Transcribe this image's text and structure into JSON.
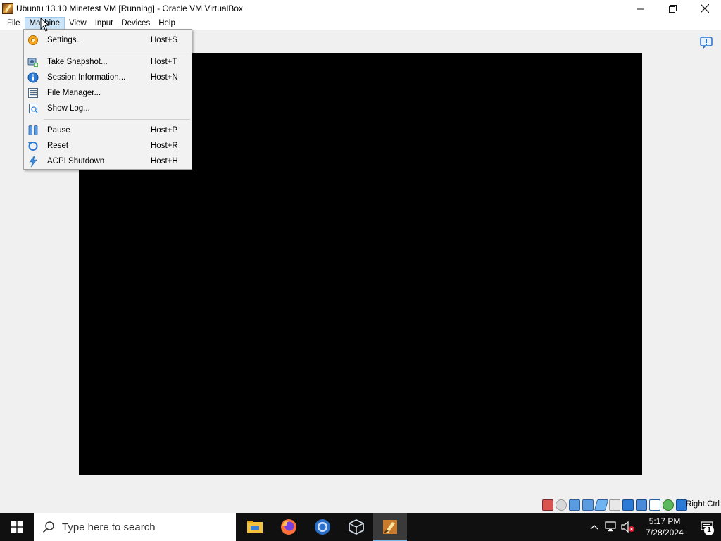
{
  "window": {
    "title": "Ubuntu 13.10 Minetest VM [Running] - Oracle VM VirtualBox",
    "controls": [
      "minimize-icon",
      "maximize-icon",
      "close-icon"
    ]
  },
  "menubar": {
    "items": [
      {
        "label": "File"
      },
      {
        "label": "Machine",
        "active": true
      },
      {
        "label": "View"
      },
      {
        "label": "Input"
      },
      {
        "label": "Devices"
      },
      {
        "label": "Help"
      }
    ]
  },
  "machine_menu": {
    "items": [
      {
        "label": "Settings...",
        "shortcut": "Host+S",
        "icon": "gear-icon"
      },
      {
        "label": "Take Snapshot...",
        "shortcut": "Host+T",
        "icon": "snapshot-icon"
      },
      {
        "label": "Session Information...",
        "shortcut": "Host+N",
        "icon": "info-icon"
      },
      {
        "label": "File Manager...",
        "shortcut": "",
        "icon": "file-manager-icon"
      },
      {
        "label": "Show Log...",
        "shortcut": "",
        "icon": "log-icon"
      },
      {
        "label": "Pause",
        "shortcut": "Host+P",
        "icon": "pause-icon"
      },
      {
        "label": "Reset",
        "shortcut": "Host+R",
        "icon": "reset-icon"
      },
      {
        "label": "ACPI Shutdown",
        "shortcut": "Host+H",
        "icon": "acpi-shutdown-icon"
      }
    ]
  },
  "statusbar": {
    "host_key": "Right Ctrl"
  },
  "taskbar": {
    "search_placeholder": "Type here to search",
    "apps": [
      "file-explorer-icon",
      "firefox-icon",
      "chrome-icon",
      "virtualbox-icon",
      "virtualbox-vm-icon"
    ],
    "clock_time": "5:17 PM",
    "clock_date": "7/28/2024",
    "notification_count": "1"
  },
  "colors": {
    "menu_active_bg": "#cce4f7",
    "taskbar_bg": "#101010",
    "vm_screen_bg": "#000000"
  }
}
